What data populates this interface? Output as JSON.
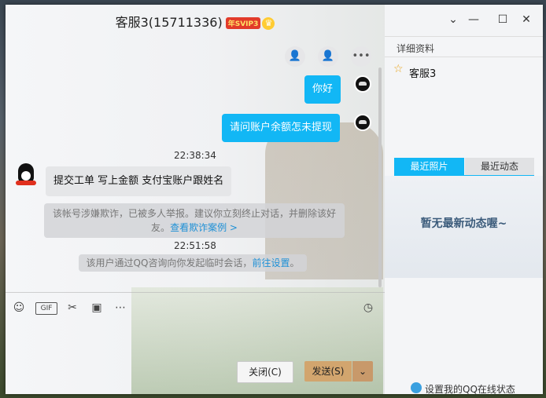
{
  "window": {
    "title": "客服3(15711336)",
    "title_badge": "年SVIP3",
    "vip_icon": "crown-icon"
  },
  "header_actions": [
    "add-friend-icon",
    "remote-assist-icon",
    "more-icon"
  ],
  "messages": [
    {
      "dir": "out",
      "text": "你好"
    },
    {
      "dir": "out",
      "text": "请问账户余额怎未提现"
    },
    {
      "type": "time",
      "text": "22:38:34"
    },
    {
      "dir": "in",
      "text": "提交工单  写上金额  支付宝账户跟姓名"
    },
    {
      "type": "system",
      "line1": "该帐号涉嫌欺诈，已被多人举报。建议你立刻终止对话，并删除该好",
      "line2": "友。",
      "link": "查看欺诈案例 >"
    },
    {
      "type": "time",
      "text": "22:51:58"
    },
    {
      "type": "system2",
      "text": "该用户通过QQ咨询向你发起临时会话，",
      "link": "前往设置",
      "tail": "。"
    }
  ],
  "toolbar": [
    "emoji-icon",
    "gif-icon",
    "scissors-icon",
    "image-icon",
    "more-icon",
    "history-icon"
  ],
  "buttons": {
    "close": "关闭(C)",
    "send": "发送(S)"
  },
  "right": {
    "section": "详细资料",
    "name": "客服3",
    "tabs": [
      "最近照片",
      "最近动态"
    ],
    "active_tab": 0,
    "empty": "暂无最新动态喔~",
    "footer": "设置我的QQ在线状态"
  },
  "colors": {
    "accent": "#12b7f5",
    "send": "#d2a56e"
  }
}
